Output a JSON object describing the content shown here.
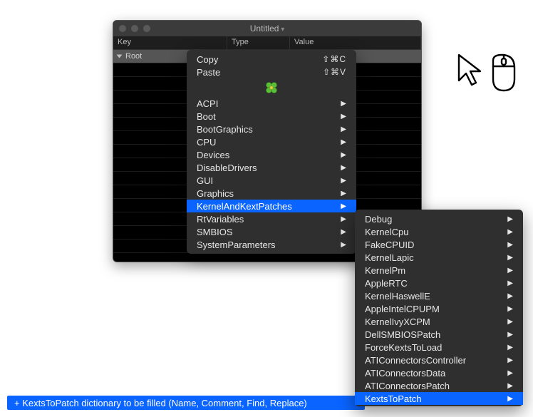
{
  "window": {
    "title": "Untitled",
    "columns": {
      "key": "Key",
      "type": "Type",
      "value": "Value"
    },
    "root_label": "Root"
  },
  "menu": {
    "copy": {
      "label": "Copy",
      "shortcut": "⇧⌘C"
    },
    "paste": {
      "label": "Paste",
      "shortcut": "⇧⌘V"
    },
    "items": [
      "ACPI",
      "Boot",
      "BootGraphics",
      "CPU",
      "Devices",
      "DisableDrivers",
      "GUI",
      "Graphics",
      "KernelAndKextPatches",
      "RtVariables",
      "SMBIOS",
      "SystemParameters"
    ],
    "selected": "KernelAndKextPatches"
  },
  "submenu": {
    "items": [
      "Debug",
      "KernelCpu",
      "FakeCPUID",
      "KernelLapic",
      "KernelPm",
      "AppleRTC",
      "KernelHaswellE",
      "AppleIntelCPUPM",
      "KernelIvyXCPM",
      "DellSMBIOSPatch",
      "ForceKextsToLoad",
      "ATIConnectorsController",
      "ATIConnectorsData",
      "ATIConnectorsPatch",
      "KextsToPatch"
    ],
    "selected": "KextsToPatch"
  },
  "status": {
    "text": "+ KextsToPatch dictionary to be filled (Name, Comment, Find, Replace)"
  }
}
